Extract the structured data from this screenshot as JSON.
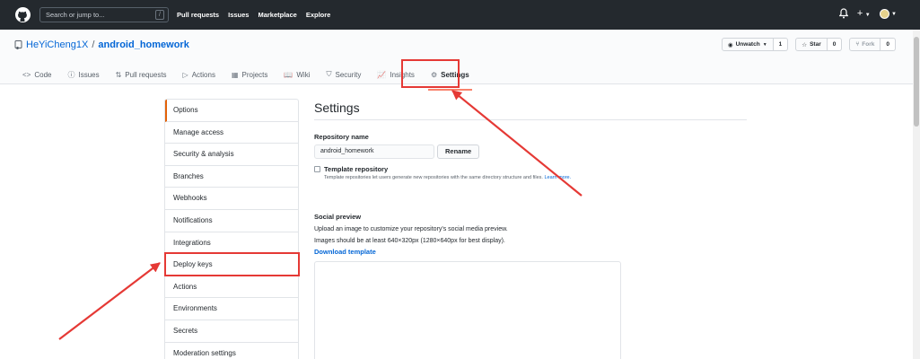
{
  "header": {
    "search_placeholder": "Search or jump to...",
    "search_shortcut": "/",
    "nav": [
      "Pull requests",
      "Issues",
      "Marketplace",
      "Explore"
    ],
    "plus_label": "+"
  },
  "repo": {
    "owner": "HeYiCheng1X",
    "separator": "/",
    "name": "android_homework",
    "watch_label": "Unwatch",
    "watch_count": "1",
    "star_label": "Star",
    "star_count": "0",
    "fork_label": "Fork",
    "fork_count": "0"
  },
  "tabs": [
    {
      "label": "Code",
      "icon": "<>"
    },
    {
      "label": "Issues",
      "icon": "ⓘ"
    },
    {
      "label": "Pull requests",
      "icon": "⇅"
    },
    {
      "label": "Actions",
      "icon": "▷"
    },
    {
      "label": "Projects",
      "icon": "▦"
    },
    {
      "label": "Wiki",
      "icon": "📖"
    },
    {
      "label": "Security",
      "icon": "⛉"
    },
    {
      "label": "Insights",
      "icon": "📈"
    },
    {
      "label": "Settings",
      "icon": "⚙"
    }
  ],
  "menu": [
    "Options",
    "Manage access",
    "Security & analysis",
    "Branches",
    "Webhooks",
    "Notifications",
    "Integrations",
    "Deploy keys",
    "Actions",
    "Environments",
    "Secrets",
    "Moderation settings"
  ],
  "settings": {
    "title": "Settings",
    "repo_name_label": "Repository name",
    "repo_name_value": "android_homework",
    "rename_label": "Rename",
    "template_label": "Template repository",
    "template_note": "Template repositories let users generate new repositories with the same directory structure and files.",
    "learn_more": "Learn more.",
    "social_title": "Social preview",
    "social_desc": "Upload an image to customize your repository's social media preview.",
    "social_size": "Images should be at least 640×320px (1280×640px for best display).",
    "download_template": "Download template"
  },
  "colors": {
    "header_bg": "#24292e",
    "link": "#0366d6",
    "annotation": "#e53935",
    "active_tab": "#f9826c"
  }
}
